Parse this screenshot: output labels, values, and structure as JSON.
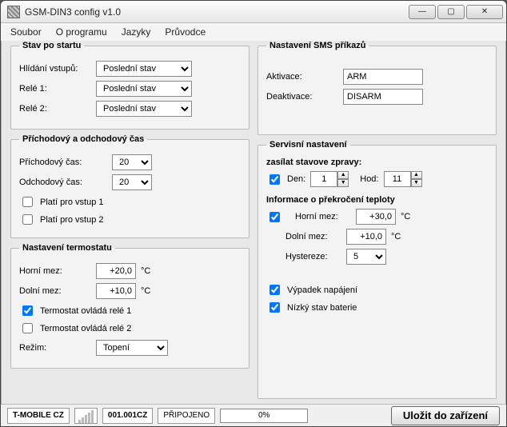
{
  "window": {
    "title": "GSM-DIN3 config v1.0"
  },
  "menu": {
    "soubor": "Soubor",
    "oprogramu": "O programu",
    "jazyky": "Jazyky",
    "pruvodce": "Průvodce"
  },
  "startup": {
    "legend": "Stav po startu",
    "hlidani_label": "Hlídání vstupů:",
    "hlidani_value": "Poslední stav",
    "rele1_label": "Relé 1:",
    "rele1_value": "Poslední stav",
    "rele2_label": "Relé 2:",
    "rele2_value": "Poslední stav"
  },
  "timing": {
    "legend": "Příchodový a odchodový čas",
    "prichod_label": "Příchodový čas:",
    "prichod_value": "20",
    "odchod_label": "Odchodový čas:",
    "odchod_value": "20",
    "plati1": "Platí pro vstup 1",
    "plati2": "Platí pro vstup 2"
  },
  "thermo": {
    "legend": "Nastavení termostatu",
    "horni_label": "Horní mez:",
    "horni_value": "+20,0",
    "dolni_label": "Dolní mez:",
    "dolni_value": "+10,0",
    "unit": "°C",
    "ovlada1": "Termostat ovládá relé 1",
    "ovlada2": "Termostat ovládá relé 2",
    "rezim_label": "Režim:",
    "rezim_value": "Topení"
  },
  "sms": {
    "legend": "Nastavení SMS příkazů",
    "aktivace_label": "Aktivace:",
    "aktivace_value": "ARM",
    "deaktivace_label": "Deaktivace:",
    "deaktivace_value": "DISARM"
  },
  "service": {
    "legend": "Servisní nastavení",
    "zasilat_hdr": "zasílat stavove zpravy:",
    "den_label": "Den:",
    "den_value": "1",
    "hod_label": "Hod:",
    "hod_value": "11",
    "teplota_hdr": "Informace o překročení teploty",
    "horni_label": "Horní mez:",
    "horni_value": "+30,0",
    "dolni_label": "Dolní mez:",
    "dolni_value": "+10,0",
    "hyst_label": "Hystereze:",
    "hyst_value": "5",
    "unit": "°C",
    "vypadek": "Výpadek napájení",
    "baterie": "Nízký stav baterie"
  },
  "status": {
    "operator": "T-MOBILE CZ",
    "code": "001.001CZ",
    "conn": "PŘIPOJENO",
    "progress": "0%",
    "save": "Uložit do zařízení"
  }
}
